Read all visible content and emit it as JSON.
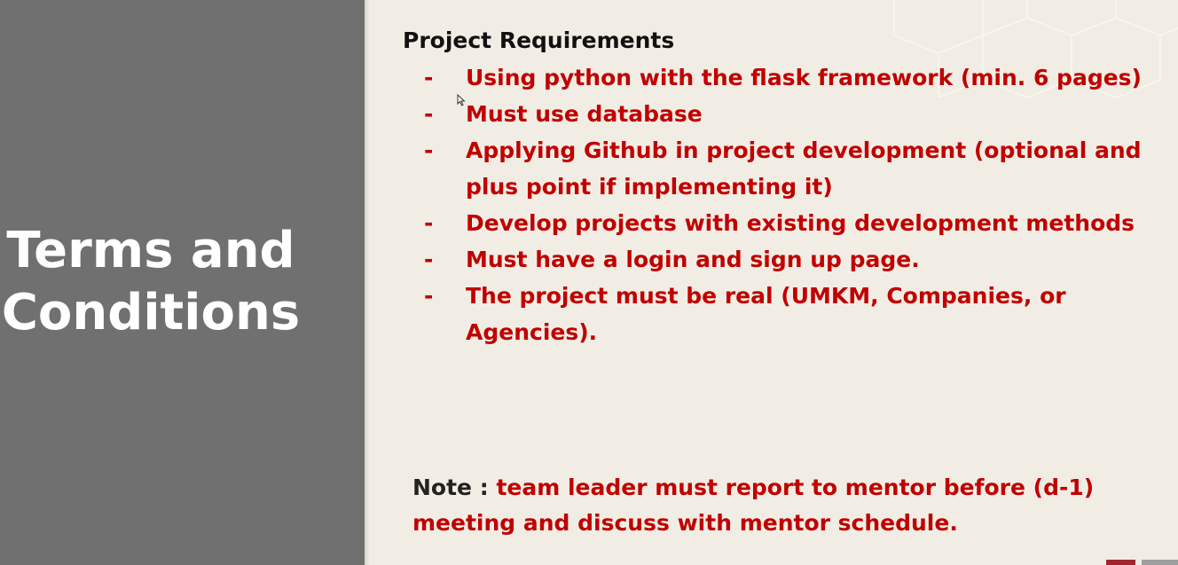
{
  "sidebar": {
    "title_line1": "Terms and",
    "title_line2": "Conditions"
  },
  "requirements": {
    "heading": "Project Requirements",
    "bullet": "-",
    "items": [
      "Using python with the flask framework (min. 6 pages)",
      "Must use database",
      "Applying Github in project development (optional and plus point if implementing it)",
      "Develop projects with existing development methods",
      "Must have a login and sign up page.",
      "The project must be real (UMKM, Companies, or Agencies)."
    ]
  },
  "note": {
    "label": "Note :",
    "text": "team leader must report to mentor before (d-1) meeting and discuss with mentor schedule."
  },
  "colors": {
    "sidebar_bg": "#707070",
    "slide_bg": "#f2ede4",
    "accent_red": "#c00000",
    "heading_text": "#111111"
  }
}
